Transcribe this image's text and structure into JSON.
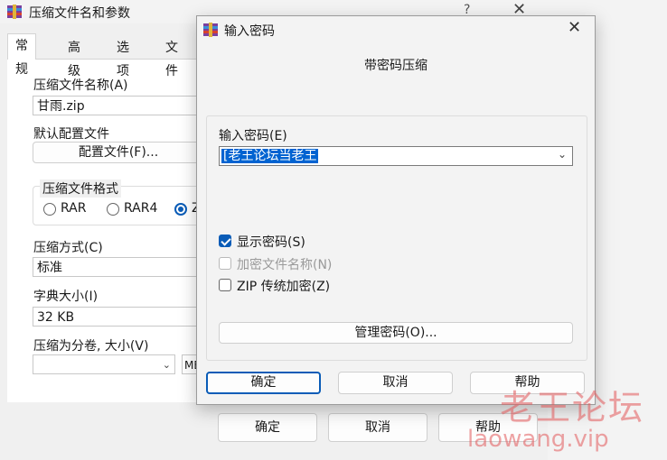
{
  "back_window": {
    "title": "压缩文件名和参数",
    "help": "?",
    "close": "✕",
    "tabs": [
      "常规",
      "高级",
      "选项",
      "文件"
    ],
    "archive_name_label": "压缩文件名称(A)",
    "archive_name_value": "甘雨.zip",
    "default_profile_label": "默认配置文件",
    "profile_button": "配置文件(F)...",
    "format_group_label": "压缩文件格式",
    "format_options": [
      "RAR",
      "RAR4",
      "Z"
    ],
    "method_label": "压缩方式(C)",
    "method_value": "标准",
    "dict_label": "字典大小(I)",
    "dict_value": "32 KB",
    "split_label": "压缩为分卷, 大小(V)",
    "split_unit": "MB",
    "ok": "确定",
    "cancel": "取消",
    "help_btn": "帮助"
  },
  "dialog": {
    "title": "输入密码",
    "close": "✕",
    "header": "带密码压缩",
    "password_label": "输入密码(E)",
    "password_value": "[老王论坛当老王",
    "show_password": "显示密码(S)",
    "encrypt_names": "加密文件名称(N)",
    "zip_legacy": "ZIP 传统加密(Z)",
    "manage_btn": "管理密码(O)...",
    "ok": "确定",
    "cancel": "取消",
    "help": "帮助"
  },
  "watermark": {
    "line1": "老王论坛",
    "line2": "laowang.vip"
  },
  "colors": {
    "accent": "#0a5cb7",
    "selection": "#0063d1",
    "watermark": "#e2585a"
  }
}
